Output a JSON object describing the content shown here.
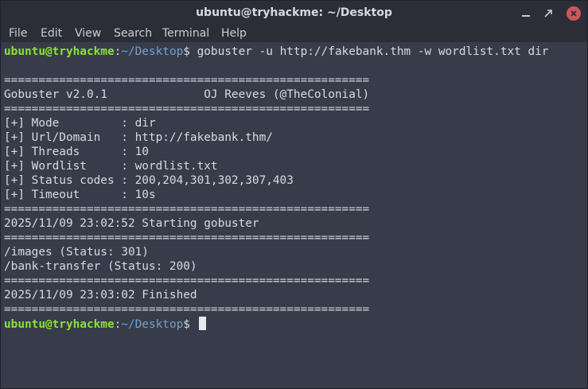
{
  "window": {
    "title": "ubuntu@tryhackme: ~/Desktop"
  },
  "menu": {
    "items": [
      "File",
      "Edit",
      "View",
      "Search",
      "Terminal",
      "Help"
    ]
  },
  "prompt": {
    "user": "ubuntu@tryhackme",
    "sep": ":",
    "path": "~/Desktop",
    "symbol": "$ "
  },
  "terminal": {
    "command": "gobuster -u http://fakebank.thm -w wordlist.txt dir",
    "separator": "=====================================================",
    "banner_title": "Gobuster v2.0.1              OJ Reeves (@TheColonial)",
    "config": [
      "[+] Mode         : dir",
      "[+] Url/Domain   : http://fakebank.thm/",
      "[+] Threads      : 10",
      "[+] Wordlist     : wordlist.txt",
      "[+] Status codes : 200,204,301,302,307,403",
      "[+] Timeout      : 10s"
    ],
    "start_line": "2025/11/09 23:02:52 Starting gobuster",
    "results": [
      "/images (Status: 301)",
      "/bank-transfer (Status: 200)"
    ],
    "finish_line": "2025/11/09 23:03:02 Finished"
  },
  "colors": {
    "terminal_bg": "#383c4a",
    "titlebar_bg": "#2b2e37",
    "prompt_user": "#8ae234",
    "prompt_path": "#729fcf",
    "close_button": "#cc575d"
  },
  "icons": {
    "minimize": "minimize-icon",
    "maximize": "maximize-icon",
    "close": "close-icon"
  }
}
